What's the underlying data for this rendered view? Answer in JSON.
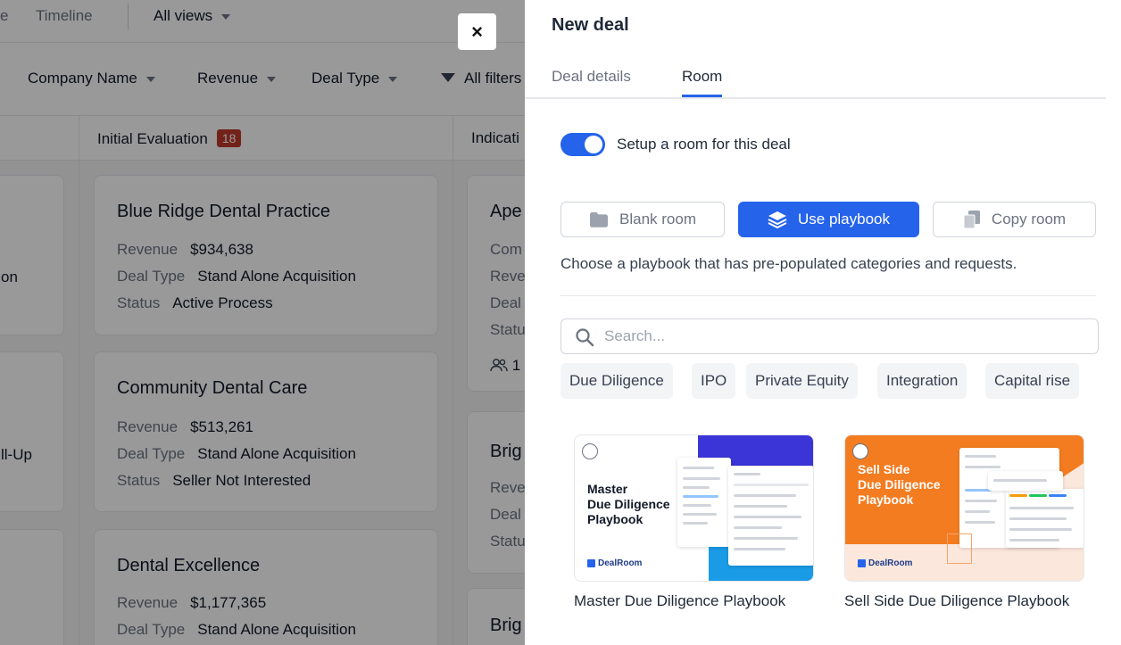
{
  "background": {
    "views": {
      "tab_fragment": "e",
      "timeline": "Timeline",
      "all_views": "All views"
    },
    "filters": {
      "company": "Company Name",
      "revenue": "Revenue",
      "deal_type": "Deal Type",
      "all": "All filters"
    },
    "columns": [
      {
        "title": "Initial Evaluation",
        "count": "18"
      },
      {
        "title": "Indicati"
      }
    ],
    "left_fragments": {
      "a": "on",
      "b": "ll-Up"
    },
    "cards": [
      {
        "title": "Blue Ridge Dental Practice",
        "revenue_label": "Revenue",
        "revenue": "$934,638",
        "deal_type_label": "Deal Type",
        "deal_type": "Stand Alone Acquisition",
        "status_label": "Status",
        "status": "Active Process"
      },
      {
        "title": "Community Dental Care",
        "revenue_label": "Revenue",
        "revenue": "$513,261",
        "deal_type_label": "Deal Type",
        "deal_type": "Stand Alone Acquisition",
        "status_label": "Status",
        "status": "Seller Not Interested"
      },
      {
        "title": "Dental Excellence",
        "revenue_label": "Revenue",
        "revenue": "$1,177,365",
        "deal_type_label": "Deal Type",
        "deal_type": "Stand Alone Acquisition"
      }
    ],
    "right_fragments": {
      "c1_title": "Ape",
      "c1_r1": "Com",
      "c1_r2": "Reve",
      "c1_r3": "Deal",
      "c1_r4": "Statu",
      "c1_people": "1",
      "c2_title": "Brig",
      "c2_r1": "Reve",
      "c2_r2": "Deal",
      "c2_r3": "Statu",
      "c3_title": "Brig"
    }
  },
  "close_label": "×",
  "drawer": {
    "title": "New deal",
    "tabs": [
      {
        "label": "Deal details"
      },
      {
        "label": "Room"
      }
    ],
    "toggle": {
      "label": "Setup a room for this deal",
      "on": true
    },
    "room_modes": [
      {
        "label": "Blank room",
        "icon": "folder-icon"
      },
      {
        "label": "Use playbook",
        "icon": "layers-icon",
        "active": true
      },
      {
        "label": "Copy room",
        "icon": "copy-icon"
      }
    ],
    "hint": "Choose a playbook that has pre-populated categories and requests.",
    "search": {
      "placeholder": "Search...",
      "value": ""
    },
    "chips": [
      "Due Diligence",
      "IPO",
      "Private Equity",
      "Integration",
      "Capital rise"
    ],
    "playbooks": [
      {
        "thumb_title": "Master\nDue Diligence\nPlaybook",
        "brand": "DealRoom",
        "caption": "Master Due Diligence Playbook"
      },
      {
        "thumb_title": "Sell Side\nDue Diligence\nPlaybook",
        "brand": "DealRoom",
        "caption": "Sell Side Due Diligence Playbook"
      }
    ]
  },
  "colors": {
    "accent": "#2563eb",
    "badge": "#c0392b",
    "orange": "#f47c20"
  }
}
